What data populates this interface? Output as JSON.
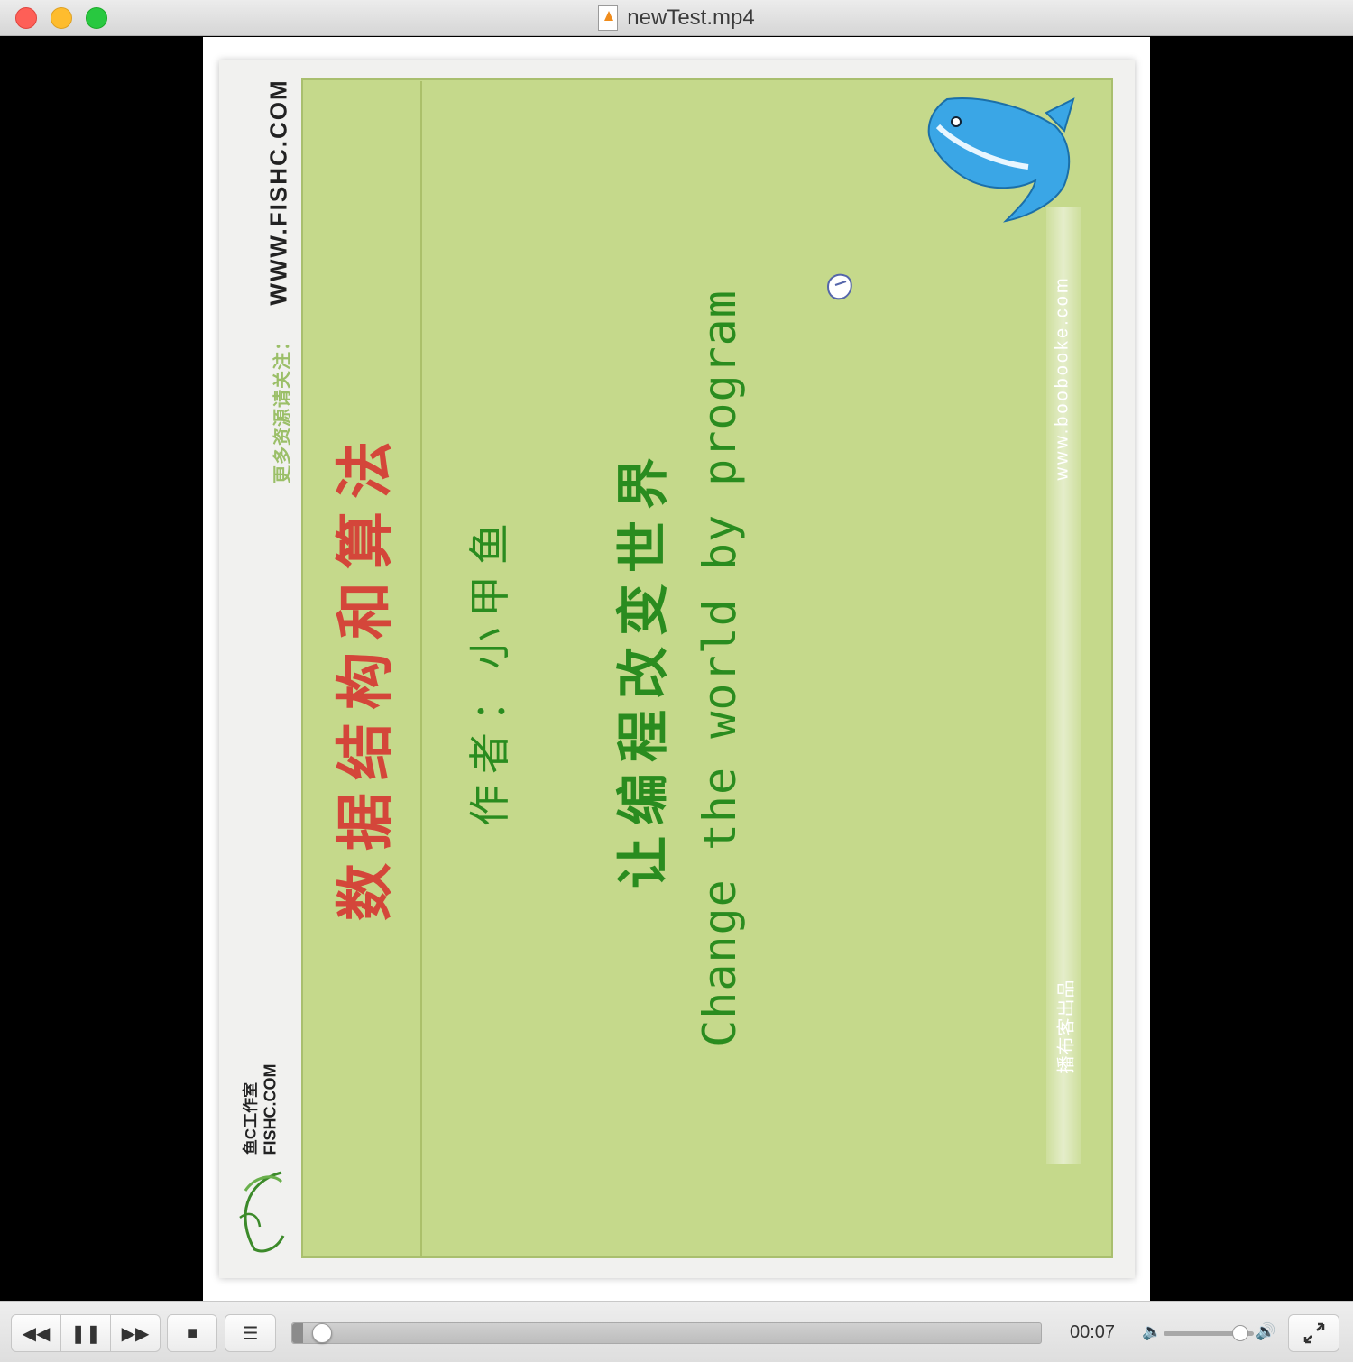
{
  "window": {
    "title": "newTest.mp4",
    "file_icon": "video-file-icon"
  },
  "video": {
    "site_url": "WWW.FISHC.COM",
    "notice": "更多资源请关注：",
    "title_cn": "数据结构和算法",
    "author": "作者：小甲鱼",
    "slogan_cn": "让编程改变世界",
    "slogan_en": "Change the world by program",
    "watermark": "www.boobooke.com",
    "producer": "播布客出品",
    "logo_line1": "鱼C工作室",
    "logo_line2": "FISHC.COM",
    "logo_mark": "鱼C"
  },
  "controls": {
    "rewind_icon": "rewind-icon",
    "pause_icon": "pause-icon",
    "fast_forward_icon": "fast-forward-icon",
    "stop_icon": "stop-icon",
    "playlist_icon": "playlist-icon",
    "fullscreen_icon": "fullscreen-icon",
    "elapsed_time": "00:07",
    "progress": 0.014,
    "volume": 0.85,
    "rewind_glyph": "◀◀",
    "pause_glyph": "❚❚",
    "ff_glyph": "▶▶",
    "stop_glyph": "■",
    "list_glyph": "☰",
    "vol_low_glyph": "🔈",
    "vol_high_glyph": "🔊"
  },
  "colors": {
    "close": "#fe5f57",
    "minimize": "#febc2e",
    "maximize": "#28c840",
    "slide_green": "#c5d98b",
    "title_red": "#d4463a",
    "text_green": "#2a8c1f"
  }
}
